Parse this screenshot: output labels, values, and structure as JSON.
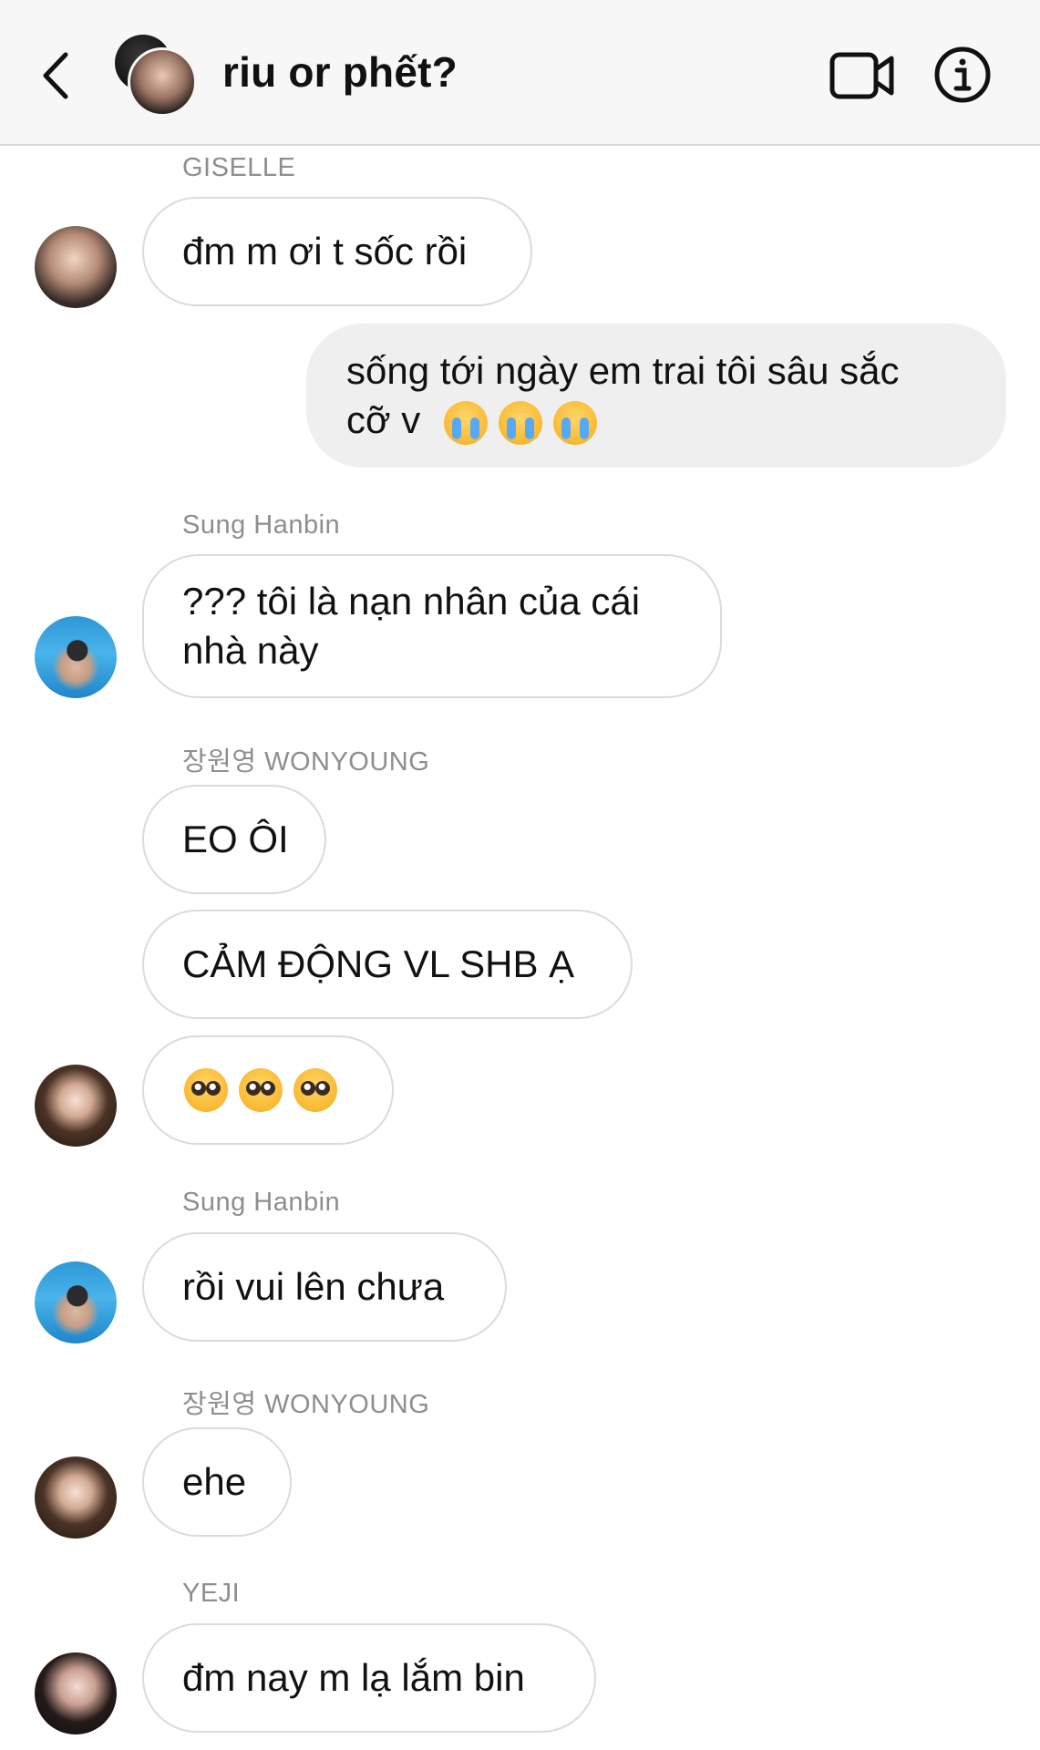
{
  "header": {
    "title": "riu or phết?",
    "back_icon": "chevron-left-icon",
    "video_icon": "video-call-icon",
    "info_icon": "info-icon"
  },
  "messages": [
    {
      "sender": "GISELLE",
      "text": "đm m ơi t sốc rồi"
    },
    {
      "sender": "",
      "outgoing": true,
      "text_line1": "sống tới ngày em trai tôi sâu sắc",
      "text_line2": "cỡ v",
      "emoji": [
        "😭",
        "😭",
        "😭"
      ]
    },
    {
      "sender": "Sung Hanbin",
      "text_line1": "??? tôi là nạn nhân của cái",
      "text_line2": "nhà này"
    },
    {
      "sender": "장원영 WONYOUNG",
      "text": "EO ÔI"
    },
    {
      "sender": "",
      "text": "CẢM ĐỘNG VL SHB Ạ"
    },
    {
      "sender": "",
      "emoji": [
        "🥺",
        "🥺",
        "🥺"
      ]
    },
    {
      "sender": "Sung Hanbin",
      "text": "rồi vui lên chưa"
    },
    {
      "sender": "장원영 WONYOUNG",
      "text": "ehe"
    },
    {
      "sender": "YEJI",
      "text": "đm nay m lạ lắm bin"
    }
  ]
}
